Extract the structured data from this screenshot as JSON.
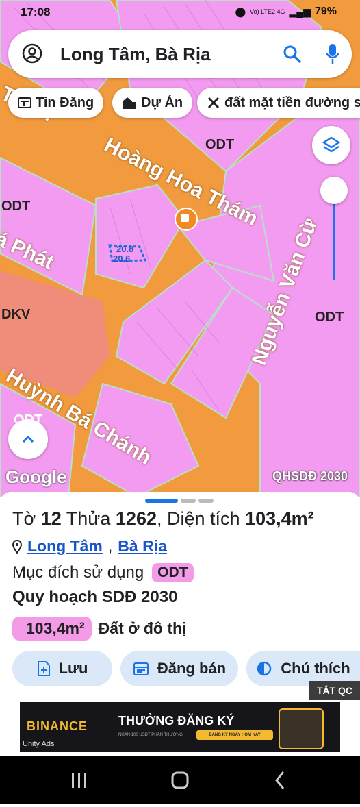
{
  "status_bar": {
    "time": "17:08",
    "network": "Vo) LTE2 4G",
    "battery": "79%"
  },
  "search": {
    "query": "Long Tâm, Bà Rịa"
  },
  "chips": [
    {
      "label": "Tin Đăng",
      "icon": "news-icon"
    },
    {
      "label": "Dự Án",
      "icon": "buildings-icon"
    },
    {
      "label": "đất mặt tiền đường s",
      "icon": "tools-icon"
    }
  ],
  "map": {
    "streets": [
      "Hoàng Hoa Thám",
      "Nguyễn Văn Cừ",
      "Huỳnh Bá Chánh",
      "á Phát",
      "Tham"
    ],
    "zones": [
      "ODT",
      "ODT",
      "ODT",
      "DKV",
      "ODT"
    ],
    "parcel_dims": [
      "20.8",
      "20.6"
    ],
    "logo": "Google",
    "layer_label": "QHSDĐ 2030"
  },
  "sheet": {
    "title_prefix": "Tờ",
    "to_number": "12",
    "thua_label": "Thửa",
    "thua_number": "1262",
    "area_label": ", Diện tích",
    "area_value": "103,4m²",
    "ward": "Long Tâm",
    "district": "Bà Rịa",
    "purpose_label": "Mục đích sử dụng",
    "purpose_code": "ODT",
    "plan_title": "Quy hoạch SDĐ 2030",
    "plan_area": "103,4m²",
    "plan_desc": "Đất ở đô thị",
    "buttons": {
      "save": "Lưu",
      "post": "Đăng bán",
      "legend": "Chú thích"
    }
  },
  "ad": {
    "close_label": "TẮT QC",
    "brand": "BINANCE",
    "headline": "THƯỞNG ĐĂNG KÝ",
    "sub": "NHẬN 100 USDT PHẦN THƯỞNG",
    "cta": "ĐĂNG KÝ NGAY HÔM NAY",
    "network": "Unity Ads"
  },
  "colors": {
    "accent": "#1a73e8",
    "road": "#f19a3e",
    "residential": "#f39bf0",
    "badge": "#f49be8",
    "button_bg": "#dbe8f8"
  }
}
